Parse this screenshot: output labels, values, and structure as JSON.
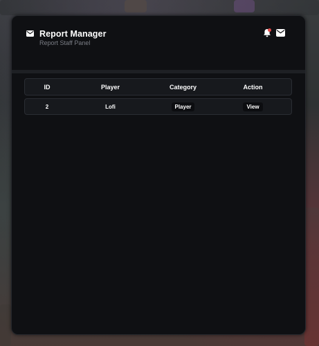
{
  "header": {
    "title": "Report Manager",
    "subtitle": "Report Staff Panel",
    "icons": [
      "envelope-icon",
      "bell-icon",
      "inbox-icon"
    ],
    "notification_dot_color": "#e04848"
  },
  "table": {
    "columns": [
      "ID",
      "Player",
      "Category",
      "Action"
    ],
    "rows": [
      {
        "id": "2",
        "player": "Lofi",
        "category": "Player",
        "action": "View"
      }
    ]
  },
  "colors": {
    "panel_bg": "#0f1013",
    "row_bg": "#17191d",
    "text": "#ffffff",
    "subtitle": "#7b7e86"
  }
}
